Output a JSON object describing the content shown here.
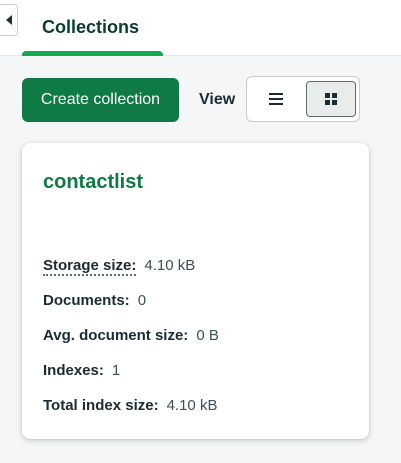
{
  "tabs": [
    {
      "label": "Collections",
      "active": true
    }
  ],
  "toolbar": {
    "create_label": "Create collection",
    "view_label": "View",
    "view_options": [
      {
        "icon": "list-icon",
        "selected": false
      },
      {
        "icon": "grid-icon",
        "selected": true
      }
    ]
  },
  "collection": {
    "name": "contactlist",
    "stats": [
      {
        "label": "Storage size:",
        "value": "4.10 kB"
      },
      {
        "label": "Documents:",
        "value": "0"
      },
      {
        "label": "Avg. document size:",
        "value": "0 B"
      },
      {
        "label": "Indexes:",
        "value": "1"
      },
      {
        "label": "Total index size:",
        "value": "4.10 kB"
      }
    ]
  },
  "colors": {
    "primary_button": "#0f7a44",
    "accent_green": "#13aa52",
    "title_green": "#0f7a44"
  }
}
